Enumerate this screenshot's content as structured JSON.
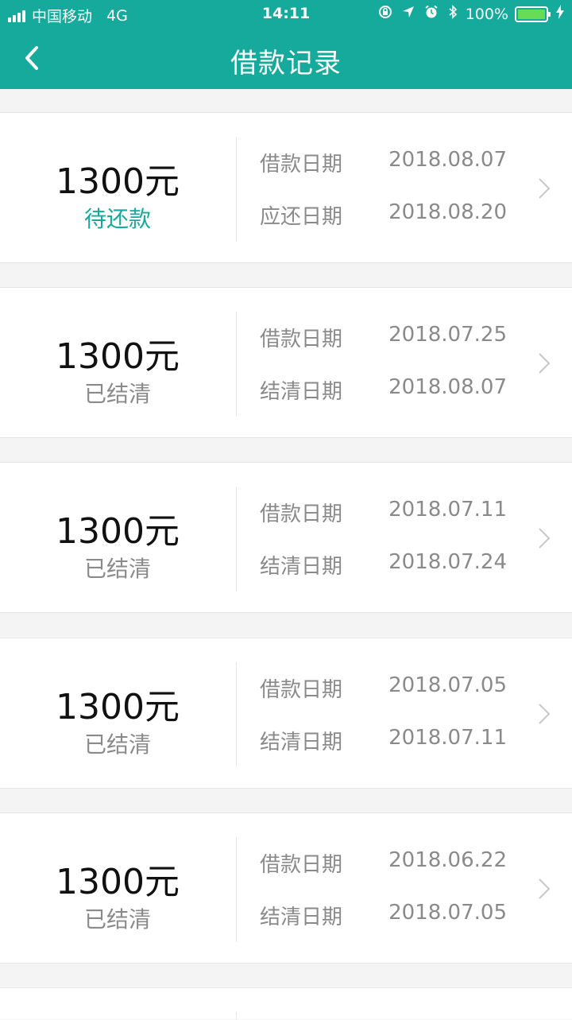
{
  "status_bar": {
    "carrier": "中国移动",
    "network": "4G",
    "time": "14:11",
    "battery": "100%",
    "icons": [
      "signal-bars-icon",
      "orientation-lock-icon",
      "location-arrow-icon",
      "alarm-icon",
      "bluetooth-icon",
      "battery-icon",
      "charging-icon"
    ]
  },
  "header": {
    "title": "借款记录",
    "back_icon": "chevron-left-icon"
  },
  "colors": {
    "accent": "#15aa9b",
    "background": "#f4f4f4",
    "card": "#ffffff",
    "muted_text": "#8a8a8a"
  },
  "records": [
    {
      "amount": "1300元",
      "status": "待还款",
      "status_type": "pending",
      "row1_label": "借款日期",
      "row1_value": "2018.08.07",
      "row2_label": "应还日期",
      "row2_value": "2018.08.20"
    },
    {
      "amount": "1300元",
      "status": "已结清",
      "status_type": "settled",
      "row1_label": "借款日期",
      "row1_value": "2018.07.25",
      "row2_label": "结清日期",
      "row2_value": "2018.08.07"
    },
    {
      "amount": "1300元",
      "status": "已结清",
      "status_type": "settled",
      "row1_label": "借款日期",
      "row1_value": "2018.07.11",
      "row2_label": "结清日期",
      "row2_value": "2018.07.24"
    },
    {
      "amount": "1300元",
      "status": "已结清",
      "status_type": "settled",
      "row1_label": "借款日期",
      "row1_value": "2018.07.05",
      "row2_label": "结清日期",
      "row2_value": "2018.07.11"
    },
    {
      "amount": "1300元",
      "status": "已结清",
      "status_type": "settled",
      "row1_label": "借款日期",
      "row1_value": "2018.06.22",
      "row2_label": "结清日期",
      "row2_value": "2018.07.05"
    }
  ]
}
